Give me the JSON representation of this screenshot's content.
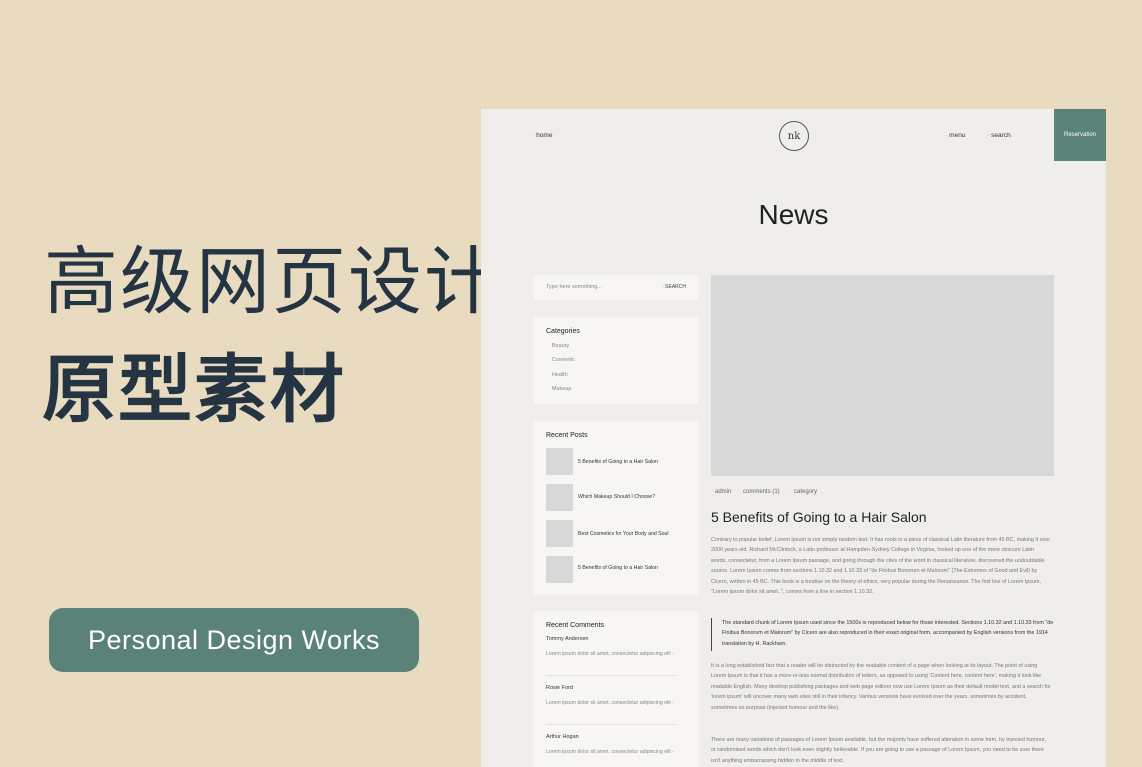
{
  "promo": {
    "title_line1": "高级网页设计",
    "title_line2": "原型素材",
    "badge": "Personal Design Works"
  },
  "nav": {
    "home": "home",
    "logo": "nk",
    "menu": "menu",
    "search": "search",
    "reservation": "Reservation"
  },
  "page_title": "News",
  "sidebar": {
    "search_placeholder": "Type here something...",
    "search_button": "SEARCH",
    "categories_heading": "Categories",
    "categories": [
      "Beauty",
      "Cosmetic",
      "Health",
      "Makeup"
    ],
    "recent_posts_heading": "Recent Posts",
    "recent_posts": [
      "5 Benefits of Going to a Hair Salon",
      "Which Makeup Should I Choose?",
      "Best Cosmetics for Your Body and Soul",
      "5 Benefits of Going to a Hair Salon"
    ],
    "recent_comments_heading": "Recent Comments",
    "recent_comments": [
      {
        "author": "Tommy Andersen",
        "text": "Lorem ipsum dolor sit amet, consectetur adipiscing elit -"
      },
      {
        "author": "Rosie Ford",
        "text": "Lorem ipsum dolor sit amet, consectetur adipiscing elit -"
      },
      {
        "author": "Arthur Hogan",
        "text": "Lorem ipsum dolor sit amet, consectetur adipiscing elit -"
      }
    ]
  },
  "article": {
    "meta_author": "admin",
    "meta_comments": "comments (1)",
    "meta_category": "category",
    "title": "5 Benefits of Going to a Hair Salon",
    "para1": "Contrary to popular belief, Lorem Ipsum is not simply random text. It has roots in a piece of classical Latin literature from 45 BC, making it over 2000 years old. Richard McClintock, a Latin professor at Hampden-Sydney College in Virginia, looked up one of the more obscure Latin words, consectetur, from a Lorem Ipsum passage, and going through the cites of the word in classical literature, discovered the undoubtable source. Lorem Ipsum comes from sections 1.10.32 and 1.10.33 of \"de Finibus Bonorum et Malorum\" (The Extremes of Good and Evil) by Cicero, written in 45 BC. This book is a treatise on the theory of ethics, very popular during the Renaissance. The first line of Lorem Ipsum, \"Lorem ipsum dolor sit amet..\", comes from a line in section 1.10.32.",
    "quote": "The standard chunk of Lorem Ipsum used since the 1500s is reproduced below for those interested. Sections 1.10.32 and 1.10.33 from \"de Finibus Bonorum et Malorum\" by Cicero are also reproduced in their exact original form, accompanied by English versions from the 1914 translation by H. Rackham.",
    "para2": "It is a long established fact that a reader will be distracted by the readable content of a page when looking at its layout. The point of using Lorem Ipsum is that it has a more-or-less normal distribution of letters, as opposed to using 'Content here, content here', making it look like readable English. Many desktop publishing packages and web page editors now use Lorem Ipsum as their default model text, and a search for 'lorem ipsum' will uncover many web sites still in their infancy. Various versions have evolved over the years, sometimes by accident, sometimes on purpose (injected humour and the like).",
    "para3": "There are many variations of passages of Lorem Ipsum available, but the majority have suffered alteration in some form, by injected humour, or randomised words which don't look even slightly believable. If you are going to use a passage of Lorem Ipsum, you need to be sure there isn't anything embarrassing hidden in the middle of text."
  },
  "colors": {
    "background": "#e8dbc0",
    "accent": "#5a8278",
    "heading_dark": "#253443"
  }
}
